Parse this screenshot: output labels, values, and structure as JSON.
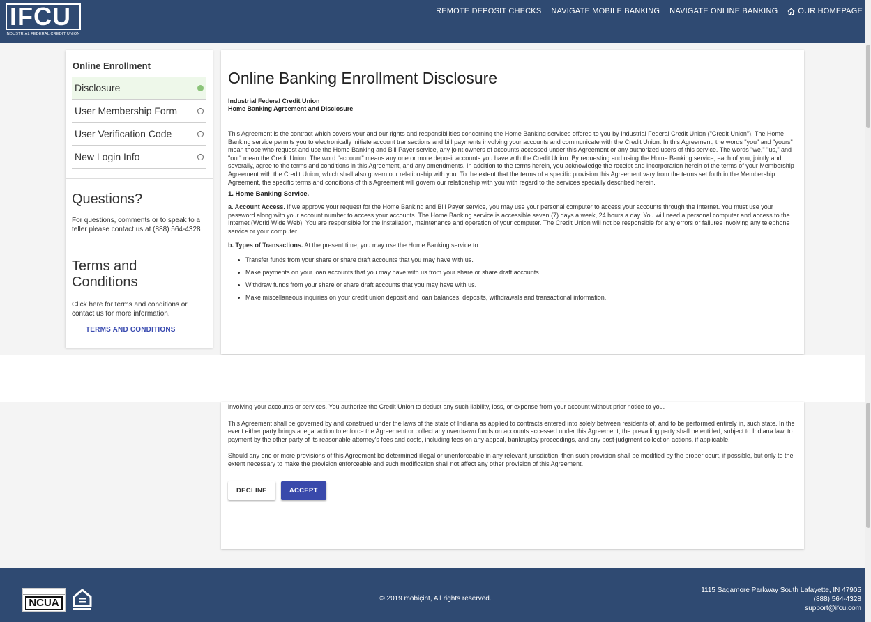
{
  "header": {
    "logo_text": "IFCU",
    "logo_subtitle": "INDUSTRIAL FEDERAL CREDIT UNION",
    "nav": [
      {
        "label": "REMOTE DEPOSIT CHECKS"
      },
      {
        "label": "NAVIGATE MOBILE BANKING"
      },
      {
        "label": "NAVIGATE ONLINE BANKING"
      },
      {
        "label": "OUR HOMEPAGE",
        "icon": "home-icon"
      }
    ]
  },
  "sidebar": {
    "heading": "Online Enrollment",
    "steps": [
      {
        "label": "Disclosure",
        "status": "active"
      },
      {
        "label": "User Membership Form",
        "status": "pending"
      },
      {
        "label": "User Verification Code",
        "status": "pending"
      },
      {
        "label": "New Login Info",
        "status": "pending"
      }
    ],
    "questions": {
      "title": "Questions?",
      "text": "For questions, comments or to speak to a teller please contact us at (888) 564-4328"
    },
    "terms": {
      "title": "Terms and Conditions",
      "text": "Click here for terms and conditions or contact us for more information.",
      "link": "TERMS AND CONDITIONS"
    }
  },
  "main": {
    "title": "Online Banking Enrollment Disclosure",
    "org_line1": "Industrial Federal Credit Union",
    "org_line2": "Home Banking Agreement and Disclosure",
    "intro": "This Agreement is the contract which covers your and our rights and responsibilities concerning the Home Banking services offered to you by Industrial Federal Credit Union (\"Credit Union\"). The Home Banking service permits you to electronically initiate account transactions and bill payments involving your accounts and communicate with the Credit Union. In this Agreement, the words \"you\" and \"yours\" mean those who request and use the Home Banking and Bill Payer service, any joint owners of accounts accessed under this Agreement or any authorized users of this service. The words \"we,\" \"us,\" and \"our\" mean the Credit Union. The word \"account\" means any one or more deposit accounts you have with the Credit Union. By requesting and using the Home Banking service, each of you, jointly and severally, agree to the terms and conditions in this Agreement, and any amendments. In addition to the terms herein, you acknowledge the receipt and incorporation herein of the terms of your Membership Agreement with the Credit Union, which shall also govern our relationship with you. To the extent that the terms of a specific provision this Agreement vary from the terms set forth in the Membership Agreement, the specific terms and conditions of this Agreement will govern our relationship with you with regard to the services specially described herein.",
    "section1": "1. Home Banking Service.",
    "access_label": "a. Account Access.",
    "access_text": "If we approve your request for the Home Banking and Bill Payer service, you may use your personal computer to access your accounts through the Internet. You must use your password along with your account number to access your accounts. The Home Banking service is accessible seven (7) days a week, 24 hours a day. You will need a personal computer and access to the Internet (World Wide Web). You are responsible for the installation, maintenance and operation of your computer. The Credit Union will not be responsible for any errors or failures involving any telephone service or your computer.",
    "types_label": "b. Types of Transactions.",
    "types_text": "At the present time, you may use the Home Banking service to:",
    "bullets": [
      "Transfer funds from your share or share draft accounts that you may have with us.",
      "Make payments on your loan accounts that you may have with us from your share or share draft accounts.",
      "Withdraw funds from your share or share draft accounts that you may have with us.",
      "Make miscellaneous inquiries on your credit union deposit and loan balances, deposits, withdrawals and transactional information."
    ],
    "enforcement_tail": "involving your accounts or services. You authorize the Credit Union to deduct any such liability, loss, or expense from your account without prior notice to you.",
    "governing": "This Agreement shall be governed by and construed under the laws of the state of Indiana as applied to contracts entered into solely between residents of, and to be performed entirely in, such state. In the event either party brings a legal action to enforce the Agreement or collect any overdrawn funds on accounts accessed under this Agreement, the prevailing party shall be entitled, subject to Indiana law, to payment by the other party of its reasonable attorney's fees and costs, including fees on any appeal, bankruptcy proceedings, and any post-judgment collection actions, if applicable.",
    "severability": "Should any one or more provisions of this Agreement be determined illegal or unenforceable in any relevant jurisdiction, then such provision shall be modified by the proper court, if possible, but only to the extent necessary to make the provision enforceable and such modification shall not affect any other provision of this Agreement.",
    "decline_label": "DECLINE",
    "accept_label": "ACCEPT"
  },
  "footer": {
    "ncua": "NCUA",
    "copyright": "© 2019 mobiçint, All rights reserved.",
    "address": "1115 Sagamore Parkway South Lafayette, IN 47905",
    "phone": "(888) 564-4328",
    "email": "support@ifcu.com"
  },
  "colors": {
    "brand": "#2f4a72",
    "accent": "#3949ab",
    "active_step": "#8cc47a"
  }
}
